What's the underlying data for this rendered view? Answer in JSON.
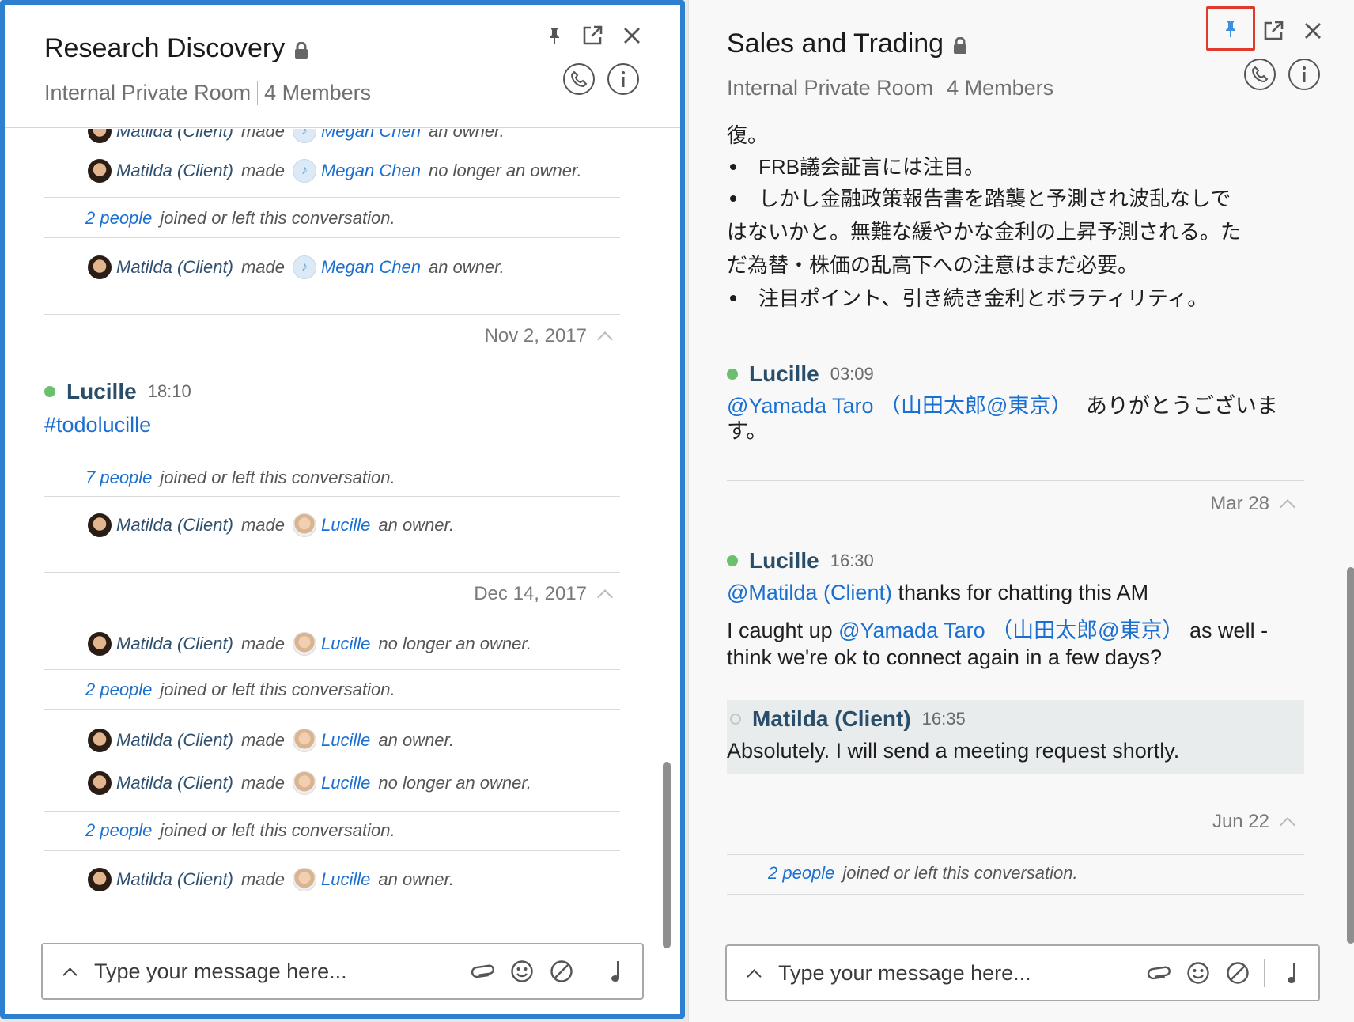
{
  "left": {
    "title": "Research Discovery",
    "subtitle": "Internal Private Room",
    "members": "4 Members",
    "events": [
      {
        "who": "Matilda (Client)",
        "verb": "made",
        "target": "Megan Chen",
        "suffix": "an owner."
      },
      {
        "who": "Matilda (Client)",
        "verb": "made",
        "target": "Megan Chen",
        "suffix": "no longer an owner."
      },
      {
        "count": "2 people",
        "text": "joined or left this conversation."
      },
      {
        "who": "Matilda (Client)",
        "verb": "made",
        "target": "Megan Chen",
        "suffix": "an owner."
      }
    ],
    "date1": "Nov 2, 2017",
    "message": {
      "author": "Lucille",
      "time": "18:10",
      "text": "#todolucille"
    },
    "events2": [
      {
        "count": "7 people",
        "text": "joined or left this conversation."
      },
      {
        "who": "Matilda (Client)",
        "verb": "made",
        "target": "Lucille",
        "suffix": "an owner."
      }
    ],
    "date2": "Dec 14, 2017",
    "events3": [
      {
        "who": "Matilda (Client)",
        "verb": "made",
        "target": "Lucille",
        "suffix": "no longer an owner."
      },
      {
        "count": "2 people",
        "text": "joined or left this conversation."
      },
      {
        "who": "Matilda (Client)",
        "verb": "made",
        "target": "Lucille",
        "suffix": "an owner."
      },
      {
        "who": "Matilda (Client)",
        "verb": "made",
        "target": "Lucille",
        "suffix": "no longer an owner."
      },
      {
        "count": "2 people",
        "text": "joined or left this conversation."
      },
      {
        "who": "Matilda (Client)",
        "verb": "made",
        "target": "Lucille",
        "suffix": "an owner."
      }
    ],
    "composer_placeholder": "Type your message here..."
  },
  "right": {
    "title": "Sales and Trading",
    "subtitle": "Internal Private Room",
    "members": "4 Members",
    "jp": {
      "line0": "復。",
      "line1": "FRB議会証言には注目。",
      "line2": "しかし金融政策報告書を踏襲と予測され波乱なしで",
      "line3": "はないかと。無難な緩やかな金利の上昇予測される。た",
      "line4": "だ為替・株価の乱高下への注意はまだ必要。",
      "line5": "注目ポイント、引き続き金利とボラティリティ。"
    },
    "msg1": {
      "author": "Lucille",
      "time": "03:09",
      "mention": "@Yamada Taro （山田太郎@東京）",
      "text_a": "ありがとうございま",
      "text_b": "す。"
    },
    "date1": "Mar 28",
    "msg2": {
      "author": "Lucille",
      "time": "16:30",
      "mention1": "@Matilda (Client)",
      "text1": " thanks for chatting this AM",
      "pre2": "I caught up ",
      "mention2": "@Yamada Taro （山田太郎@東京）",
      "post2": " as well -",
      "line3": "think we're ok to connect again in a few days?"
    },
    "reply": {
      "author": "Matilda (Client)",
      "time": "16:35",
      "text": "Absolutely. I will send a meeting request shortly."
    },
    "date2": "Jun 22",
    "event": {
      "count": "2 people",
      "text": "joined or left this conversation."
    },
    "composer_placeholder": "Type your message here..."
  },
  "colors": {
    "accent": "#2e7fcf",
    "link": "#1a6fd1",
    "online": "#6cbf6c",
    "highlight": "#e03a2f",
    "pin_active": "#3d8fe0"
  },
  "icons": [
    "lock-icon",
    "pin-icon",
    "popout-icon",
    "close-icon",
    "phone-icon",
    "info-icon",
    "chevron-up-icon",
    "paperclip-icon",
    "emoji-icon",
    "block-icon",
    "music-note-icon"
  ]
}
